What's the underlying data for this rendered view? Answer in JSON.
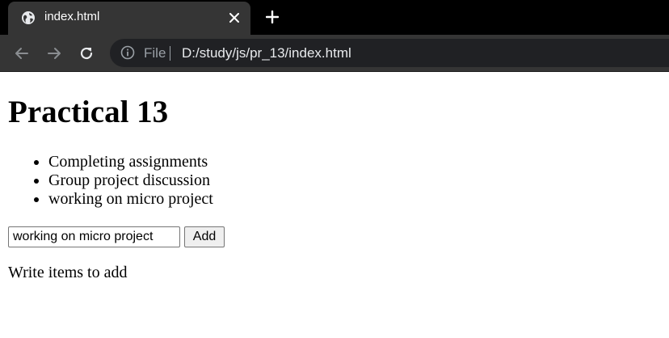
{
  "browser": {
    "tab": {
      "title": "index.html",
      "favicon": "globe-icon",
      "close_icon": "close-icon"
    },
    "new_tab_icon": "plus-icon",
    "nav": {
      "back_icon": "arrow-left-icon",
      "forward_icon": "arrow-right-icon",
      "reload_icon": "reload-icon"
    },
    "omnibox": {
      "info_icon": "info-icon",
      "scheme_label": "File",
      "url": "D:/study/js/pr_13/index.html"
    }
  },
  "page": {
    "title": "Practical 13",
    "items": [
      "Completing assignments",
      "Group project discussion",
      "working on micro project"
    ],
    "input_value": "working on micro project",
    "add_button_label": "Add",
    "hint_text": "Write items to add"
  }
}
